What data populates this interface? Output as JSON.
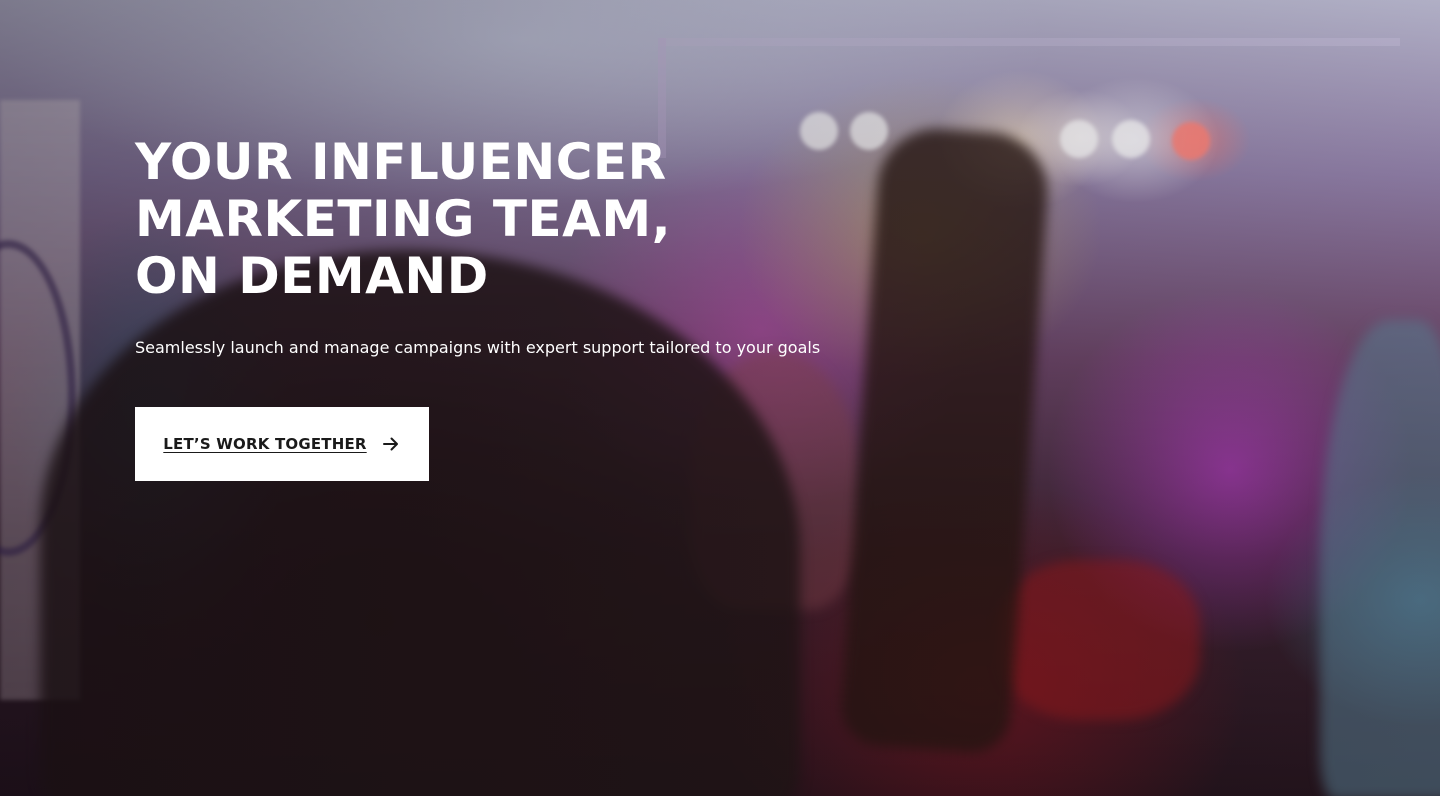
{
  "hero": {
    "headline_lines": [
      "YOUR INFLUENCER",
      "MARKETING TEAM,",
      "ON DEMAND"
    ],
    "subtext": "Seamlessly launch and manage campaigns with expert support tailored to your goals",
    "cta_label": "LET’S WORK TOGETHER",
    "cta_icon": "arrow-right-icon"
  },
  "colors": {
    "text_primary": "#ffffff",
    "button_bg": "#ffffff",
    "button_text": "#1a1a1a"
  }
}
